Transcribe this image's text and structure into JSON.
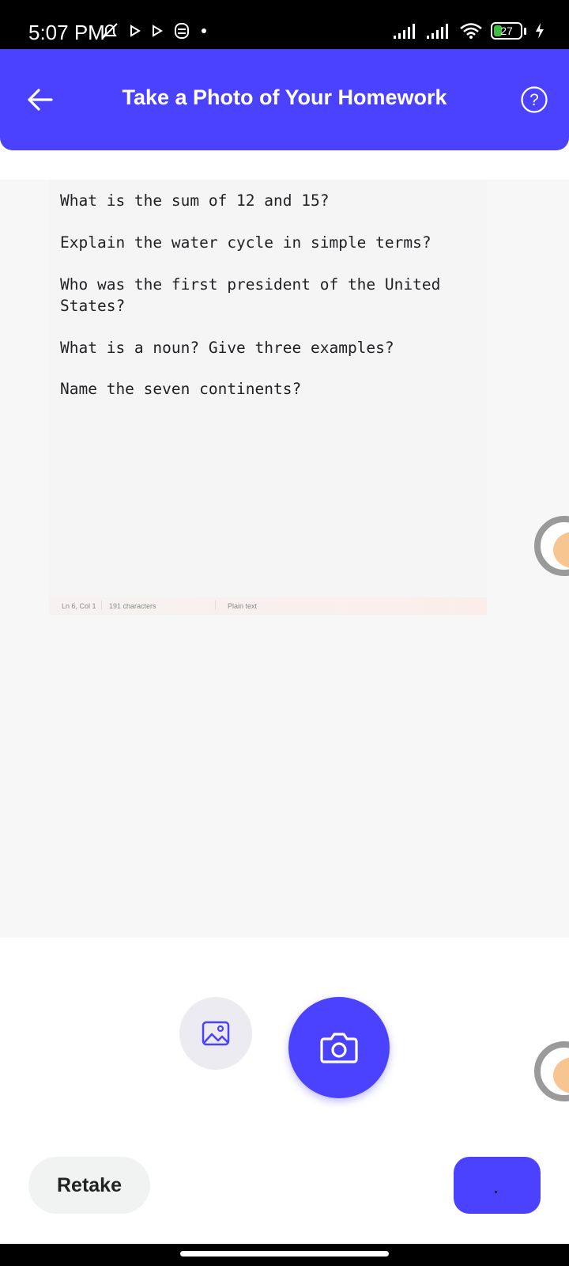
{
  "status_bar": {
    "time": "5:07 PM",
    "battery_level": "27",
    "icons": [
      "alarm-off-icon",
      "play-icon",
      "play-icon",
      "vpn-icon",
      "dot-icon",
      "signal-icon",
      "signal-icon",
      "wifi-icon",
      "battery-icon",
      "charging-icon"
    ]
  },
  "header": {
    "title": "Take a Photo of Your Homework",
    "background": "#4b42ff"
  },
  "photo": {
    "lines": [
      "What is the sum of 12 and 15?",
      "Explain the water cycle in simple terms?",
      "Who was the first president of the United States?",
      "What is a noun? Give three examples?",
      "Name the seven continents?"
    ],
    "editor_status": {
      "position": "Ln 6, Col 1",
      "characters": "191 characters",
      "format": "Plain text"
    }
  },
  "actions": {
    "retake_label": "Retake"
  },
  "colors": {
    "accent": "#4b42ff",
    "gallery_bg": "#ebebf1",
    "retake_bg": "#f1f2f2"
  }
}
